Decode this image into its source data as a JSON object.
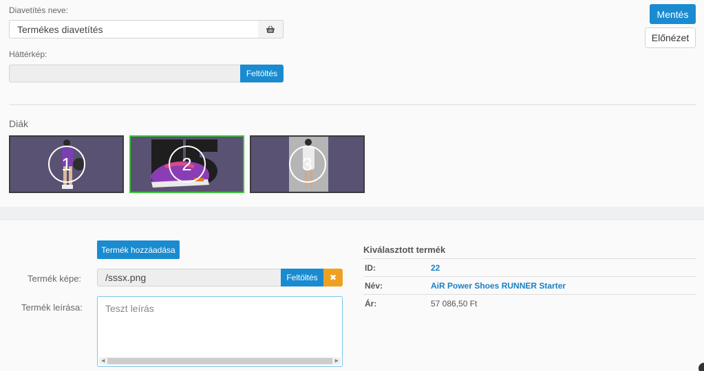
{
  "slideshow": {
    "name_label": "Diavetítés neve:",
    "name_value": "Termékes diavetítés",
    "bg_label": "Háttérkép:",
    "bg_value": "",
    "bg_upload": "Feltöltés"
  },
  "actions": {
    "save": "Mentés",
    "preview": "Előnézet"
  },
  "slides": {
    "title": "Diák",
    "items": [
      {
        "num": "1"
      },
      {
        "num": "2"
      },
      {
        "num": "3"
      }
    ]
  },
  "product": {
    "add_button": "Termék hozzáadása",
    "image_label": "Termék képe:",
    "image_value": "/sssx.png",
    "image_upload": "Feltöltés",
    "image_clear": "✖",
    "desc_label": "Termék leírása:",
    "desc_value": "Teszt leírás"
  },
  "selected": {
    "title": "Kiválasztott termék",
    "id_label": "ID:",
    "id_value": "22",
    "name_label": "Név:",
    "name_value": "AiR Power Shoes RUNNER Starter",
    "price_label": "Ár:",
    "price_value": "57 086,50 Ft"
  },
  "colors": {
    "accent": "#1a8bd0",
    "active_slide": "#38c638",
    "clear": "#f0a020"
  }
}
